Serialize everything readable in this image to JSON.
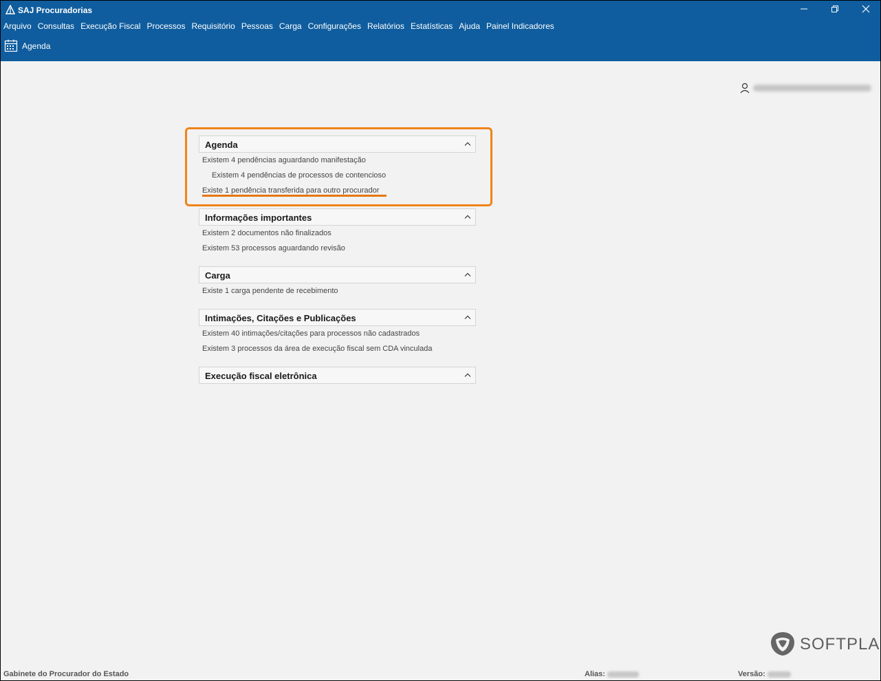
{
  "window": {
    "title": "SAJ Procuradorias"
  },
  "menu": {
    "items": [
      "Arquivo",
      "Consultas",
      "Execução Fiscal",
      "Processos",
      "Requisitório",
      "Pessoas",
      "Carga",
      "Configurações",
      "Relatórios",
      "Estatísticas",
      "Ajuda",
      "Painel Indicadores"
    ]
  },
  "toolbar": {
    "agenda_label": "Agenda"
  },
  "sections": [
    {
      "title": "Agenda",
      "lines": [
        {
          "text": "Existem 4 pendências aguardando manifestação",
          "indent": false
        },
        {
          "text": "Existem 4 pendências de processos de contencioso",
          "indent": true
        },
        {
          "text": "Existe 1 pendência transferida para outro procurador",
          "indent": false
        }
      ]
    },
    {
      "title": "Informações importantes",
      "lines": [
        {
          "text": "Existem 2 documentos não finalizados",
          "indent": false
        },
        {
          "text": "Existem 53 processos aguardando revisão",
          "indent": false
        }
      ]
    },
    {
      "title": "Carga",
      "lines": [
        {
          "text": "Existe 1 carga pendente de recebimento",
          "indent": false
        }
      ]
    },
    {
      "title": "Intimações, Citações e Publicações",
      "lines": [
        {
          "text": "Existem 40 intimações/citações para processos não cadastrados",
          "indent": false
        },
        {
          "text": "Existem 3 processos da área de execução fiscal sem CDA vinculada",
          "indent": false
        }
      ]
    },
    {
      "title": "Execução fiscal eletrônica",
      "lines": []
    }
  ],
  "logo": {
    "text": "SOFTPLAN"
  },
  "status": {
    "location": "Gabinete do Procurador do Estado",
    "alias_label": "Alias:",
    "versao_label": "Versão:"
  },
  "colors": {
    "titlebar": "#0f5d9e",
    "highlight": "#f0831a",
    "background": "#f2f2f2"
  }
}
